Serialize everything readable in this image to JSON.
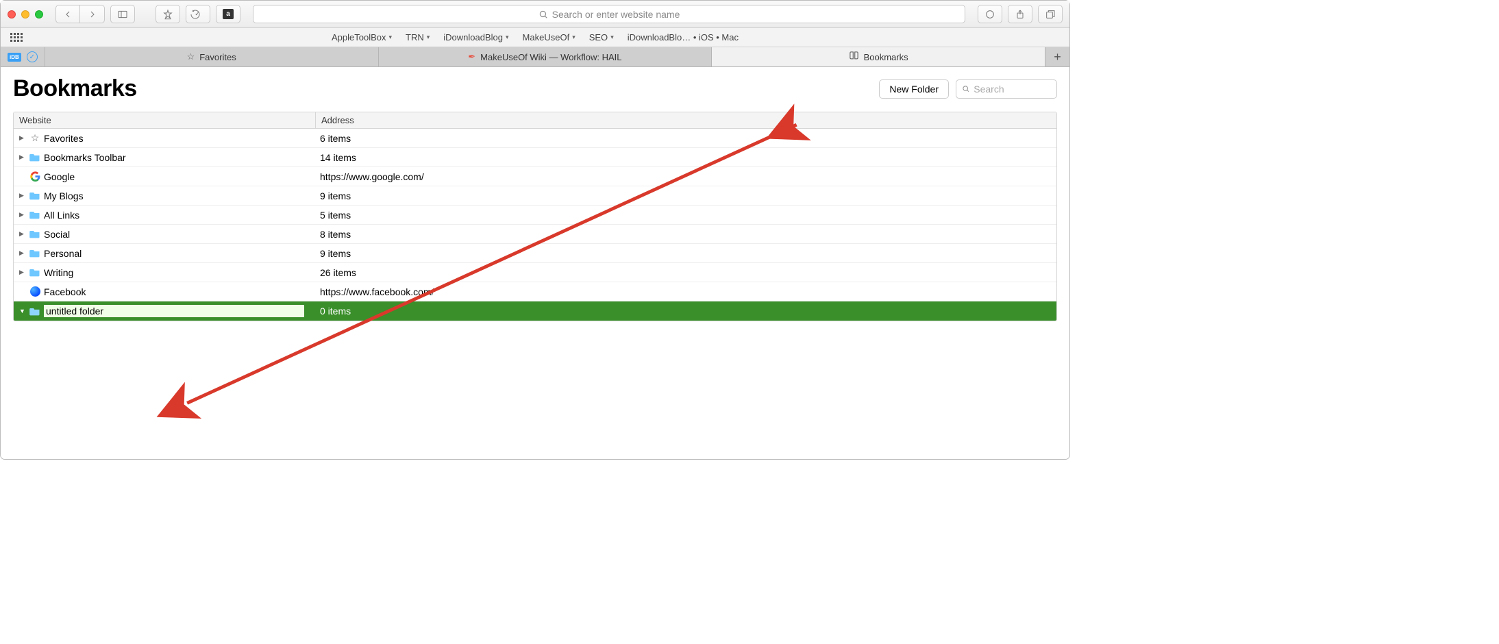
{
  "urlbar": {
    "placeholder": "Search or enter website name"
  },
  "favorites_bar": {
    "items": [
      {
        "label": "AppleToolBox",
        "dropdown": true
      },
      {
        "label": "TRN",
        "dropdown": true
      },
      {
        "label": "iDownloadBlog",
        "dropdown": true
      },
      {
        "label": "MakeUseOf",
        "dropdown": true
      },
      {
        "label": "SEO",
        "dropdown": true
      },
      {
        "label": "iDownloadBlo… • iOS • Mac",
        "dropdown": false
      }
    ]
  },
  "tabs": [
    {
      "label": "Favorites",
      "icon": "star",
      "active": false
    },
    {
      "label": "MakeUseOf Wiki — Workflow: HAIL",
      "icon": "quill",
      "active": false
    },
    {
      "label": "Bookmarks",
      "icon": "book",
      "active": true
    }
  ],
  "page": {
    "title": "Bookmarks",
    "new_folder_label": "New Folder",
    "search_placeholder": "Search"
  },
  "table": {
    "col_website": "Website",
    "col_address": "Address",
    "rows": [
      {
        "type": "folder",
        "disclosure": "closed",
        "icon": "star",
        "name": "Favorites",
        "address": "6 items"
      },
      {
        "type": "folder",
        "disclosure": "closed",
        "icon": "folder",
        "name": "Bookmarks Toolbar",
        "address": "14 items"
      },
      {
        "type": "link",
        "disclosure": "none",
        "icon": "google",
        "name": "Google",
        "address": "https://www.google.com/"
      },
      {
        "type": "folder",
        "disclosure": "closed",
        "icon": "folder",
        "name": "My Blogs",
        "address": "9 items"
      },
      {
        "type": "folder",
        "disclosure": "closed",
        "icon": "folder",
        "name": "All Links",
        "address": "5 items"
      },
      {
        "type": "folder",
        "disclosure": "closed",
        "icon": "folder",
        "name": "Social",
        "address": "8 items"
      },
      {
        "type": "folder",
        "disclosure": "closed",
        "icon": "folder",
        "name": "Personal",
        "address": "9 items"
      },
      {
        "type": "folder",
        "disclosure": "closed",
        "icon": "folder",
        "name": "Writing",
        "address": "26 items"
      },
      {
        "type": "link",
        "disclosure": "none",
        "icon": "globe",
        "name": "Facebook",
        "address": "https://www.facebook.com/"
      },
      {
        "type": "folder",
        "disclosure": "open",
        "icon": "folder",
        "name": "untitled folder",
        "address": "0 items",
        "selected": true,
        "editing": true
      }
    ]
  },
  "side_pill": "iDB"
}
